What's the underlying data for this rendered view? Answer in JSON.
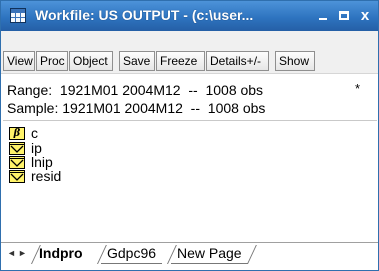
{
  "window": {
    "title": "Workfile: US OUTPUT - (c:\\user...",
    "close_glyph": "x"
  },
  "toolbar": {
    "buttons": [
      "View",
      "Proc",
      "Object",
      "Save",
      "Freeze",
      "Details+/-",
      "Show"
    ]
  },
  "info": {
    "range_line": "Range:  1921M01 2004M12  --  1008 obs",
    "sample_line": "Sample: 1921M01 2004M12  --  1008 obs",
    "modified_marker": "*"
  },
  "objects": [
    {
      "name": "c",
      "icon": "coefficient-icon",
      "glyph": "β"
    },
    {
      "name": "ip",
      "icon": "series-icon"
    },
    {
      "name": "lnip",
      "icon": "series-icon"
    },
    {
      "name": "resid",
      "icon": "series-icon"
    }
  ],
  "tabs": [
    {
      "label": "Indpro",
      "active": true
    },
    {
      "label": "Gdpc96",
      "active": false
    },
    {
      "label": "New Page",
      "active": false
    }
  ],
  "nav": {
    "left": "◄",
    "right": "►"
  },
  "colors": {
    "titlebar": "#2e74c0",
    "series_icon_fill": "#fff36a"
  }
}
